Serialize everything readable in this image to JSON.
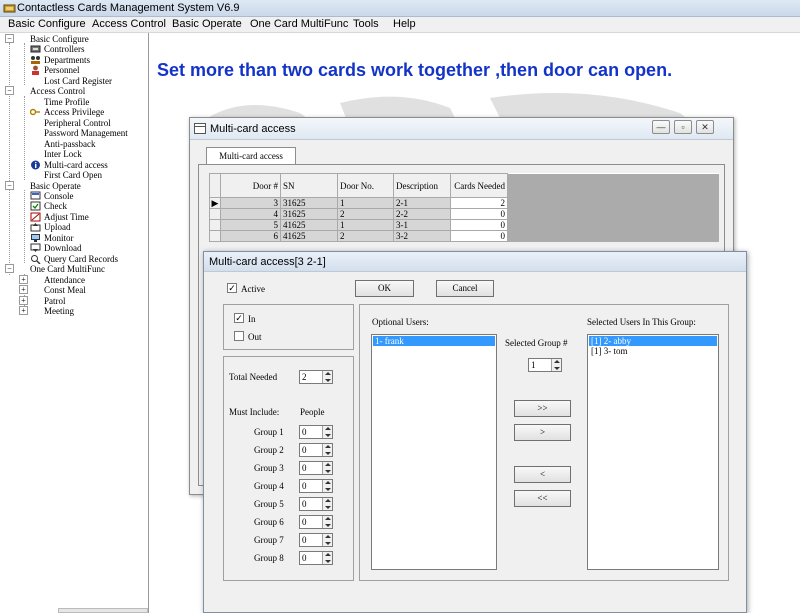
{
  "app": {
    "title": "Contactless Cards Management System  V6.9"
  },
  "menu": [
    {
      "label": "Basic Configure"
    },
    {
      "label": "Access Control"
    },
    {
      "label": "Basic Operate"
    },
    {
      "label": "One Card MultiFunc"
    },
    {
      "label": "Tools"
    },
    {
      "label": "Help"
    }
  ],
  "tree": {
    "basic_configure": "Basic Configure",
    "controllers": "Controllers",
    "departments": "Departments",
    "personnel": "Personnel",
    "lost_card_register": "Lost Card Register",
    "access_control": "Access Control",
    "time_profile": "Time Profile",
    "access_privilege": "Access Privilege",
    "peripheral_control": "Peripheral Control",
    "password_management": "Password Management",
    "anti_passback": "Anti-passback",
    "inter_lock": "Inter Lock",
    "multi_card_access": "Multi-card access",
    "first_card_open": "First Card Open",
    "basic_operate": "Basic Operate",
    "console": "Console",
    "check": "Check",
    "adjust_time": "Adjust Time",
    "upload": "Upload",
    "monitor": "Monitor",
    "download": "Download",
    "query_card_records": "Query Card Records",
    "one_card_multifunc": "One Card MultiFunc",
    "attendance": "Attendance",
    "const_meal": "Const Meal",
    "patrol": "Patrol",
    "meeting": "Meeting"
  },
  "banner": "Set more than two cards work together ,then door can open.",
  "win1": {
    "title": "Multi-card access",
    "tab": "Multi-card access",
    "columns": {
      "door_num": "Door #",
      "sn": "SN",
      "door_no": "Door No.",
      "description": "Description",
      "cards_needed": "Cards Needed"
    },
    "rows": [
      {
        "door": "3",
        "sn": "31625",
        "no": "1",
        "desc": "2-1",
        "cards": "2"
      },
      {
        "door": "4",
        "sn": "31625",
        "no": "2",
        "desc": "2-2",
        "cards": "0"
      },
      {
        "door": "5",
        "sn": "41625",
        "no": "1",
        "desc": "3-1",
        "cards": "0"
      },
      {
        "door": "6",
        "sn": "41625",
        "no": "2",
        "desc": "3-2",
        "cards": "0"
      }
    ]
  },
  "win2": {
    "title": "Multi-card access[3   2-1]",
    "active_label": "Active",
    "ok_label": "OK",
    "cancel_label": "Cancel",
    "in_label": "In",
    "out_label": "Out",
    "total_needed_label": "Total Needed",
    "total_needed_value": "2",
    "must_include_label": "Must Include:",
    "people_label": "People",
    "groups": [
      {
        "label": "Group 1",
        "value": "0"
      },
      {
        "label": "Group 2",
        "value": "0"
      },
      {
        "label": "Group 3",
        "value": "0"
      },
      {
        "label": "Group 4",
        "value": "0"
      },
      {
        "label": "Group 5",
        "value": "0"
      },
      {
        "label": "Group 6",
        "value": "0"
      },
      {
        "label": "Group 7",
        "value": "0"
      },
      {
        "label": "Group 8",
        "value": "0"
      }
    ],
    "optional_users_label": "Optional Users:",
    "optional_users": [
      "1- frank"
    ],
    "selected_group_label": "Selected Group #",
    "selected_group_value": "1",
    "selected_users_label": "Selected Users In This Group:",
    "selected_users": [
      "[1] 2- abby",
      "[1] 3- tom"
    ],
    "btn_add_all": ">>",
    "btn_add": ">",
    "btn_remove": "<",
    "btn_remove_all": "<<"
  }
}
